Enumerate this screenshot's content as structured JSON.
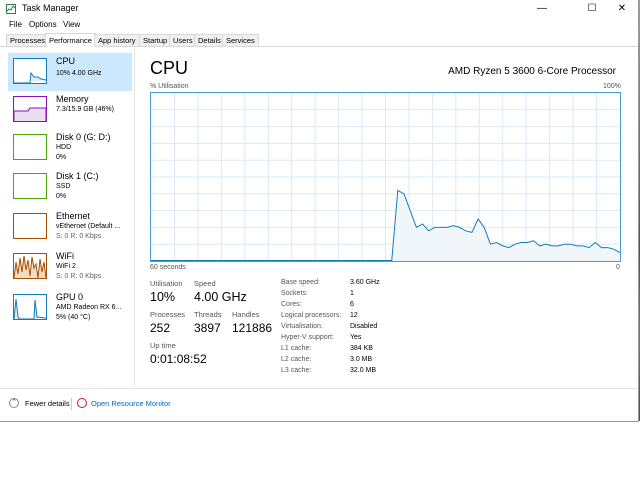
{
  "window": {
    "title": "Task Manager",
    "controls": {
      "minimize": "—",
      "maximize": "☐",
      "close": "✕"
    }
  },
  "menu": [
    {
      "label": "File"
    },
    {
      "label": "Options"
    },
    {
      "label": "View"
    }
  ],
  "tabs": [
    {
      "label": "Processes"
    },
    {
      "label": "Performance"
    },
    {
      "label": "App history"
    },
    {
      "label": "Startup"
    },
    {
      "label": "Users"
    },
    {
      "label": "Details"
    },
    {
      "label": "Services"
    }
  ],
  "active_tab": "Performance",
  "sidebar": [
    {
      "name": "CPU",
      "line1": "10%  4.00 GHz",
      "line2": "",
      "color": "#117dbb"
    },
    {
      "name": "Memory",
      "line1": "7.3/15.9 GB (46%)",
      "line2": "",
      "color": "#8b12ae"
    },
    {
      "name": "Disk 0 (G: D:)",
      "line1": "HDD",
      "line2": "0%",
      "color": "#4da60c"
    },
    {
      "name": "Disk 1 (C:)",
      "line1": "SSD",
      "line2": "0%",
      "color": "#4da60c"
    },
    {
      "name": "Ethernet",
      "line1": "vEthernet (Default ...",
      "line2": "S: 0  R: 0 Kbps",
      "color": "#a74f01"
    },
    {
      "name": "WiFi",
      "line1": "WiFi 2",
      "line2": "S: 0  R: 0 Kbps",
      "color": "#a74f01"
    },
    {
      "name": "GPU 0",
      "line1": "AMD Radeon RX 6...",
      "line2": "5%  (40 °C)",
      "color": "#117dbb"
    }
  ],
  "main": {
    "title": "CPU",
    "processor": "AMD Ryzen 5 3600 6-Core Processor",
    "graph_top_left": "% Utilisation",
    "graph_top_right": "100%",
    "graph_bottom_left": "60 seconds",
    "graph_bottom_right": "0",
    "graph_color": "#117dbb",
    "utilisation_series": [
      0,
      0,
      0,
      0,
      0,
      0,
      0,
      0,
      0,
      0,
      0,
      0,
      0,
      0,
      0,
      0,
      0,
      0,
      0,
      0,
      0,
      0,
      0,
      0,
      0,
      0,
      0,
      0,
      0,
      0,
      0,
      0,
      0,
      0,
      0,
      0,
      0,
      0,
      0,
      0,
      42,
      40,
      30,
      20,
      22,
      18,
      20,
      20,
      20,
      21,
      20,
      18,
      17,
      25,
      20,
      10,
      11,
      9,
      8,
      10,
      11,
      11,
      12,
      9,
      10,
      9,
      9,
      10,
      10,
      9,
      9,
      8,
      11,
      8,
      8,
      7,
      5
    ]
  },
  "stats": {
    "utilisation": {
      "label": "Utilisation",
      "value": "10%"
    },
    "speed": {
      "label": "Speed",
      "value": "4.00 GHz"
    },
    "processes": {
      "label": "Processes",
      "value": "252"
    },
    "threads": {
      "label": "Threads",
      "value": "3897"
    },
    "handles": {
      "label": "Handles",
      "value": "121886"
    },
    "uptime": {
      "label": "Up time",
      "value": "0:01:08:52"
    }
  },
  "specs": [
    {
      "label": "Base speed:",
      "value": "3.60 GHz"
    },
    {
      "label": "Sockets:",
      "value": "1"
    },
    {
      "label": "Cores:",
      "value": "6"
    },
    {
      "label": "Logical processors:",
      "value": "12"
    },
    {
      "label": "Virtualisation:",
      "value": "Disabled"
    },
    {
      "label": "Hyper-V support:",
      "value": "Yes"
    },
    {
      "label": "L1 cache:",
      "value": "384 KB"
    },
    {
      "label": "L2 cache:",
      "value": "3.0 MB"
    },
    {
      "label": "L3 cache:",
      "value": "32.0 MB"
    }
  ],
  "footer": {
    "fewer_details": "Fewer details",
    "resource_monitor": "Open Resource Monitor"
  }
}
